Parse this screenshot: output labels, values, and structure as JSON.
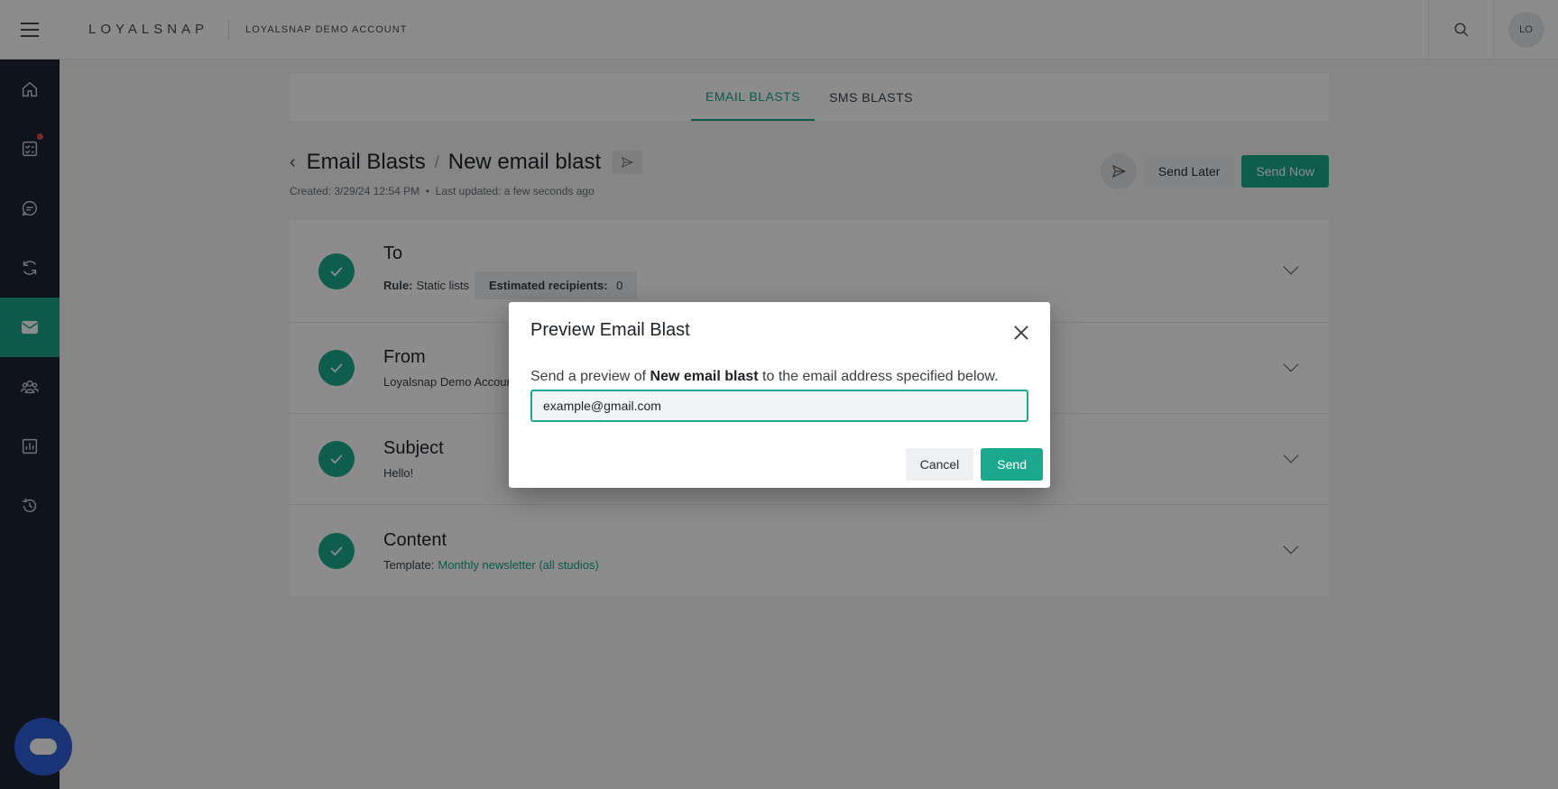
{
  "header": {
    "logo": "LOYALSNAP",
    "account_name": "LOYALSNAP DEMO ACCOUNT",
    "avatar_initials": "LO"
  },
  "sidebar": {
    "items": [
      {
        "name": "home-icon"
      },
      {
        "name": "tasks-icon",
        "has_notification": true
      },
      {
        "name": "chat-icon"
      },
      {
        "name": "refresh-icon"
      },
      {
        "name": "mail-icon",
        "active": true
      },
      {
        "name": "members-icon"
      },
      {
        "name": "reports-icon"
      },
      {
        "name": "history-icon"
      }
    ]
  },
  "tabs": [
    {
      "label": "EMAIL BLASTS",
      "active": true
    },
    {
      "label": "SMS BLASTS",
      "active": false
    }
  ],
  "breadcrumb": {
    "parent": "Email Blasts",
    "separator": "/",
    "current": "New email blast"
  },
  "meta": {
    "created": "Created: 3/29/24 12:54 PM",
    "separator": "•",
    "updated": "Last updated: a few seconds ago"
  },
  "actions": {
    "send_later": "Send Later",
    "send_now": "Send Now"
  },
  "sections": {
    "to": {
      "title": "To",
      "rule_label": "Rule:",
      "rule_value": "Static lists",
      "recipients_label": "Estimated recipients:",
      "recipients_value": "0"
    },
    "from": {
      "title": "From",
      "value": "Loyalsnap Demo Accoun"
    },
    "subject": {
      "title": "Subject",
      "value": "Hello!"
    },
    "content": {
      "title": "Content",
      "template_label": "Template:",
      "template_value": "Monthly newsletter (all studios)"
    }
  },
  "modal": {
    "title": "Preview Email Blast",
    "text_before": "Send a preview of",
    "text_bold": "New email blast",
    "text_after": "to the email address specified below.",
    "email_value": "example@gmail.com",
    "cancel_label": "Cancel",
    "send_label": "Send"
  },
  "colors": {
    "accent": "#1aa98d",
    "sidebar_bg": "#1d2433",
    "chat_bubble": "#2f5fd8"
  }
}
